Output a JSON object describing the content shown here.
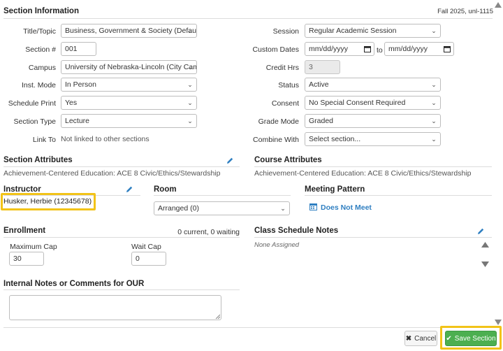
{
  "header": {
    "title": "Section Information",
    "term": "Fall 2025, unl-1115"
  },
  "left_fields": {
    "title_label": "Title/Topic",
    "title_value": "Business, Government & Society (Defaul",
    "section_label": "Section #",
    "section_value": "001",
    "campus_label": "Campus",
    "campus_value": "University of Nebraska-Lincoln (City Cam",
    "inst_mode_label": "Inst. Mode",
    "inst_mode_value": "In Person",
    "schedule_print_label": "Schedule Print",
    "schedule_print_value": "Yes",
    "section_type_label": "Section Type",
    "section_type_value": "Lecture",
    "link_to_label": "Link To",
    "link_to_value": "Not linked to other sections"
  },
  "right_fields": {
    "session_label": "Session",
    "session_value": "Regular Academic Session",
    "custom_dates_label": "Custom Dates",
    "date_start_placeholder": "mm/dd/yyyy",
    "to_label": "to",
    "date_end_placeholder": "mm/dd/yyyy",
    "credit_hrs_label": "Credit Hrs",
    "credit_hrs_value": "3",
    "status_label": "Status",
    "status_value": "Active",
    "consent_label": "Consent",
    "consent_value": "No Special Consent Required",
    "grade_mode_label": "Grade Mode",
    "grade_mode_value": "Graded",
    "combine_with_label": "Combine With",
    "combine_with_value": "Select section..."
  },
  "section_attributes": {
    "title": "Section Attributes",
    "text": "Achievement-Centered Education: ACE 8 Civic/Ethics/Stewardship"
  },
  "course_attributes": {
    "title": "Course Attributes",
    "text": "Achievement-Centered Education: ACE 8 Civic/Ethics/Stewardship"
  },
  "instructor": {
    "title": "Instructor",
    "name": "Husker, Herbie (12345678)"
  },
  "room": {
    "title": "Room",
    "value": "Arranged (0)"
  },
  "meeting_pattern": {
    "title": "Meeting Pattern",
    "link": "Does Not Meet"
  },
  "enrollment": {
    "title": "Enrollment",
    "summary": "0 current, 0 waiting",
    "max_cap_label": "Maximum Cap",
    "max_cap_value": "30",
    "wait_cap_label": "Wait Cap",
    "wait_cap_value": "0"
  },
  "class_schedule_notes": {
    "title": "Class Schedule Notes",
    "empty": "None Assigned"
  },
  "internal_notes": {
    "title": "Internal Notes or Comments for OUR",
    "value": ""
  },
  "footer": {
    "cancel_label": "Cancel",
    "save_label": "Save Section"
  },
  "colors": {
    "accent_blue": "#2f7fc1",
    "save_green": "#4caf50",
    "highlight_yellow": "#f2c318"
  },
  "icons": [
    "pencil-icon",
    "calendar-icon",
    "chevron-down-icon",
    "close-icon",
    "check-icon",
    "scroll-up-icon",
    "scroll-down-icon"
  ]
}
